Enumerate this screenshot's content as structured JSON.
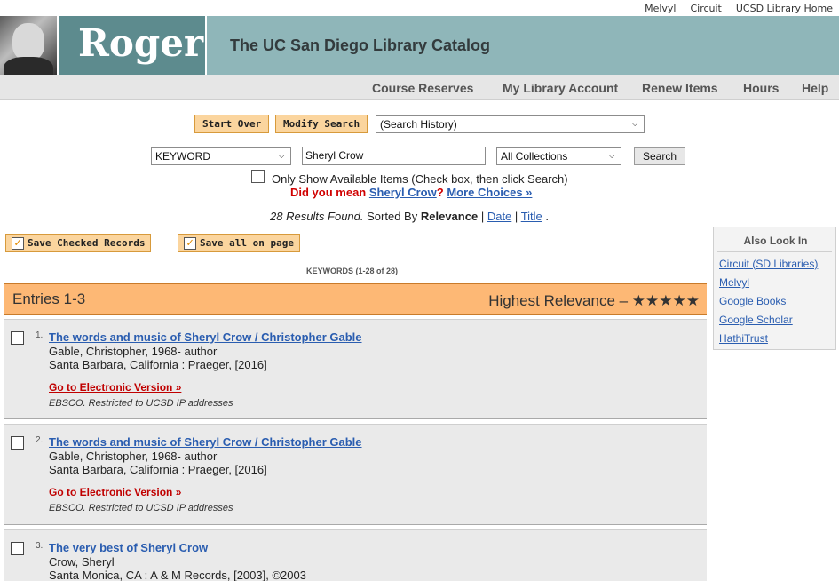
{
  "top_links": [
    "Melvyl",
    "Circuit",
    "UCSD Library Home"
  ],
  "header": {
    "logo_text": "Roger",
    "catalog_title": "The UC San Diego Library Catalog"
  },
  "nav": [
    "Course Reserves",
    "My Library Account",
    "Renew Items",
    "Hours",
    "Help"
  ],
  "search": {
    "start_over": "Start Over",
    "modify_search": "Modify Search",
    "history_select": "(Search History)",
    "type_select": "KEYWORD",
    "query_value": "Sheryl Crow",
    "collection_select": "All Collections",
    "search_button": "Search",
    "available_label": "Only Show Available Items (Check box, then click Search)",
    "did_you_mean_prefix": "Did you mean",
    "suggestion": "Sheryl Crow",
    "suggestion_mark": "?",
    "more_choices": "More Choices »"
  },
  "results_summary": {
    "count_text": "28 Results Found.",
    "sorted_by": "Sorted By",
    "sort_current": "Relevance",
    "sep1": "|",
    "sort_date": "Date",
    "sep2": "|",
    "sort_title": "Title",
    "end": "."
  },
  "save": {
    "checked": "Save Checked Records",
    "all": "Save all on page"
  },
  "keywords_line": "KEYWORDS (1-28 of 28)",
  "entries": {
    "label": "Entries 1-3",
    "relevance": "Highest Relevance – ★★★★★"
  },
  "results": [
    {
      "num": "1.",
      "title": "The words and music of Sheryl Crow / Christopher Gable",
      "author": "Gable, Christopher, 1968- author",
      "pub": "Santa Barbara, California : Praeger, [2016]",
      "elink": "Go to Electronic Version »",
      "note": "EBSCO. Restricted to UCSD IP addresses"
    },
    {
      "num": "2.",
      "title": "The words and music of Sheryl Crow / Christopher Gable",
      "author": "Gable, Christopher, 1968- author",
      "pub": "Santa Barbara, California : Praeger, [2016]",
      "elink": "Go to Electronic Version »",
      "note": "EBSCO. Restricted to UCSD IP addresses"
    },
    {
      "num": "3.",
      "title": "The very best of Sheryl Crow",
      "author": "Crow, Sheryl",
      "pub": "Santa Monica, CA : A & M Records, [2003], ©2003"
    }
  ],
  "also_look_in": {
    "title": "Also Look In",
    "links": [
      "Circuit (SD Libraries)",
      "Melvyl",
      "Google Books",
      "Google Scholar",
      "HathiTrust"
    ]
  },
  "colors": {
    "banner": "#8fb6b9",
    "logo_block": "#5d8b8e",
    "orange_button": "#fbd59e",
    "entries_header": "#fdb875",
    "link": "#2a5db0",
    "alert_red": "#d00000"
  }
}
